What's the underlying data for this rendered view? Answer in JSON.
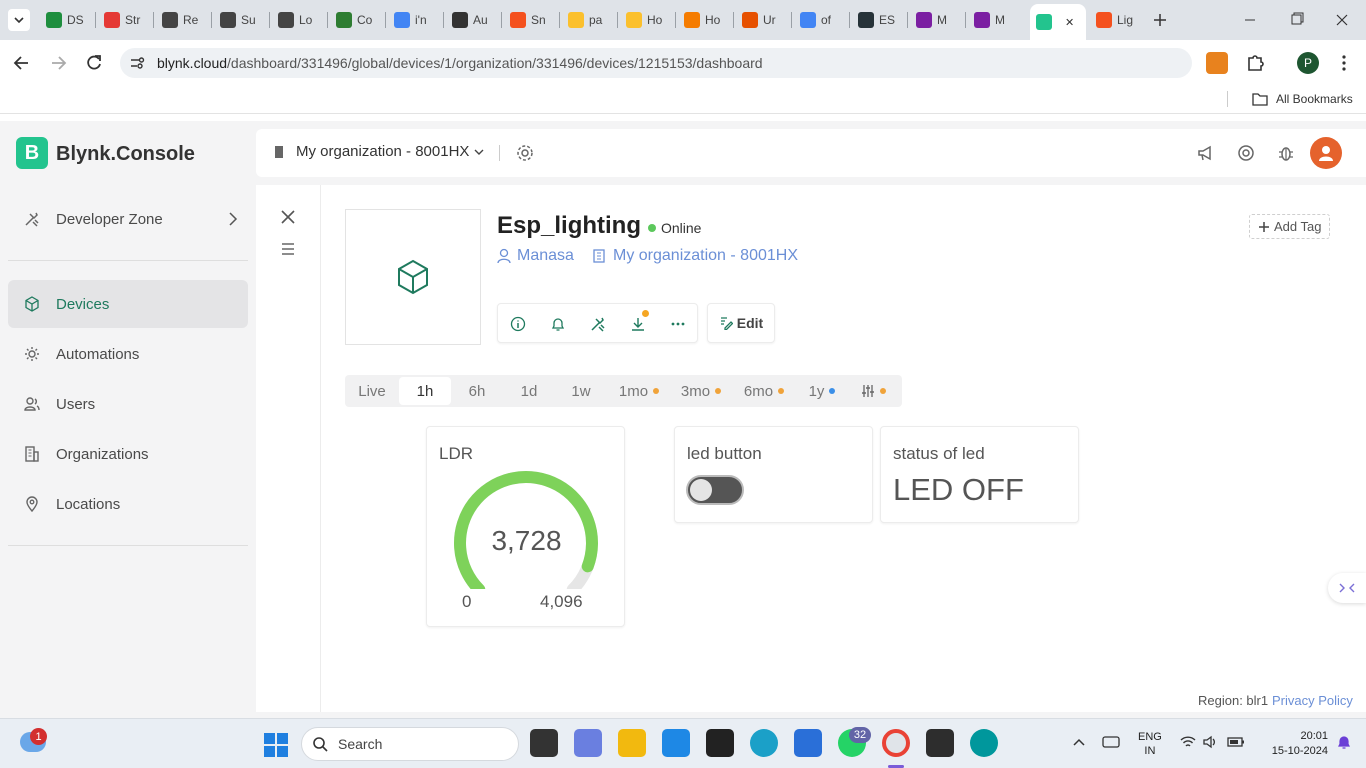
{
  "browser": {
    "tabs": [
      {
        "label": "DS",
        "color": "#1e8e3e"
      },
      {
        "label": "Str",
        "color": "#e53935"
      },
      {
        "label": "Re",
        "color": "#444444"
      },
      {
        "label": "Su",
        "color": "#444444"
      },
      {
        "label": "Lo",
        "color": "#444444"
      },
      {
        "label": "Co",
        "color": "#2e7d32"
      },
      {
        "label": "i'n",
        "color": "#4285f4"
      },
      {
        "label": "Au",
        "color": "#333333"
      },
      {
        "label": "Sn",
        "color": "#f4511e"
      },
      {
        "label": "pa",
        "color": "#fbc02d"
      },
      {
        "label": "Ho",
        "color": "#fbc02d"
      },
      {
        "label": "Ho",
        "color": "#f57c00"
      },
      {
        "label": "Ur",
        "color": "#e65100"
      },
      {
        "label": "of",
        "color": "#4285f4"
      },
      {
        "label": "ES",
        "color": "#263238"
      },
      {
        "label": "M",
        "color": "#7b1fa2"
      },
      {
        "label": "M",
        "color": "#7b1fa2"
      },
      {
        "label": "",
        "color": "#23c48e"
      },
      {
        "label": "Lig",
        "color": "#f4511e"
      }
    ],
    "url_host": "blynk.cloud",
    "url_path": "/dashboard/331496/global/devices/1/organization/331496/devices/1215153/dashboard",
    "bookmarks_label": "All Bookmarks",
    "profile_initial": "P"
  },
  "app": {
    "brand_letter": "B",
    "brand_name": "Blynk.Console",
    "org_selector": "My organization - 8001HX",
    "nav": [
      {
        "label": "Developer Zone"
      },
      {
        "label": "Devices"
      },
      {
        "label": "Automations"
      },
      {
        "label": "Users"
      },
      {
        "label": "Organizations"
      },
      {
        "label": "Locations"
      }
    ],
    "device": {
      "name": "Esp_lighting",
      "status": "Online",
      "owner": "Manasa",
      "organization": "My organization - 8001HX",
      "add_tag": "Add Tag",
      "edit_label": "Edit"
    },
    "time_ranges": [
      {
        "label": "Live",
        "dot": ""
      },
      {
        "label": "1h",
        "dot": ""
      },
      {
        "label": "6h",
        "dot": ""
      },
      {
        "label": "1d",
        "dot": ""
      },
      {
        "label": "1w",
        "dot": ""
      },
      {
        "label": "1mo",
        "dot": "#f0a33a"
      },
      {
        "label": "3mo",
        "dot": "#f0a33a"
      },
      {
        "label": "6mo",
        "dot": "#f0a33a"
      },
      {
        "label": "1y",
        "dot": "#3b8fe8"
      }
    ],
    "widgets": {
      "ldr": {
        "title": "LDR",
        "value": "3,728",
        "min": "0",
        "max": "4,096",
        "fraction": 0.91
      },
      "led_button": {
        "title": "led button",
        "state": "off"
      },
      "led_status": {
        "title": "status of led",
        "value": "LED OFF"
      }
    },
    "footer": {
      "region": "Region: blr1",
      "privacy": "Privacy Policy"
    }
  },
  "taskbar": {
    "search": "Search",
    "weather_badge": "1",
    "whatsapp_badge": "32",
    "lang_line1": "ENG",
    "lang_line2": "IN",
    "time": "20:01",
    "date": "15-10-2024"
  },
  "colors": {
    "accent": "#23c48e",
    "gauge": "#7ed25a",
    "online": "#5cc85c",
    "link": "#6b8fd6"
  }
}
